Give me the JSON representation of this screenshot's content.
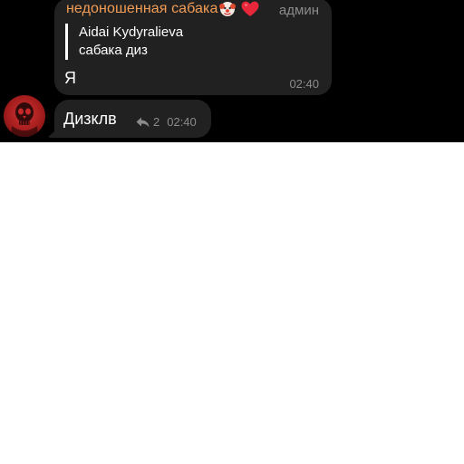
{
  "messages": [
    {
      "sender": "недоношенная сабака",
      "sender_emoji_icons": [
        "clown-face-icon",
        "red-heart-icon"
      ],
      "role": "админ",
      "reply_to": {
        "author": "Aidai Kydyralieva",
        "text": "сабака диз"
      },
      "text": "Я",
      "time": "02:40"
    },
    {
      "text": "Дизклв",
      "reply_icon": "reply-arrow-icon",
      "reply_count": "2",
      "time": "02:40",
      "avatar_icon": "skull-avatar-icon"
    }
  ],
  "colors": {
    "background": "#000000",
    "bubble": "#212121",
    "sender_name": "#f29d57",
    "meta_text": "#8b8b8b",
    "avatar": "#c42828"
  }
}
